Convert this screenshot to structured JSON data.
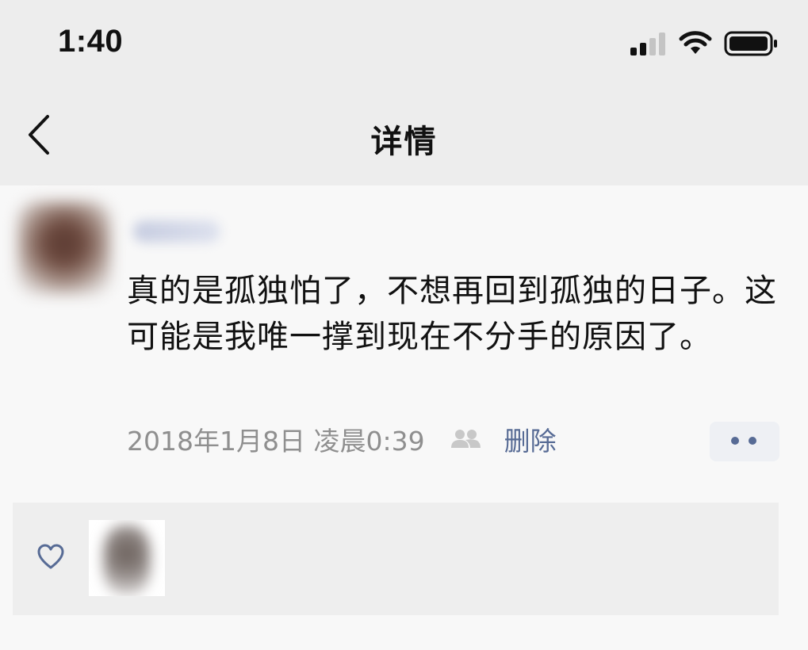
{
  "status_bar": {
    "time": "1:40",
    "icons": [
      "cellular-signal-icon",
      "wifi-icon",
      "battery-icon"
    ]
  },
  "nav": {
    "back_icon": "chevron-left-icon",
    "title": "详情"
  },
  "post": {
    "text": "真的是孤独怕了，不想再回到孤独的日子。这可能是我唯一撑到现在不分手的原因了。",
    "timestamp": "2018年1月8日 凌晨0:39",
    "visibility_icon": "friends-icon",
    "delete_label": "删除",
    "more_icon": "more-dots-icon"
  },
  "likes": {
    "icon": "heart-outline-icon"
  },
  "colors": {
    "link": "#576b95",
    "meta_text": "#8f8f8f",
    "nav_background": "#ededed",
    "page_background": "#f8f8f8",
    "likes_background": "#eeeeee"
  }
}
